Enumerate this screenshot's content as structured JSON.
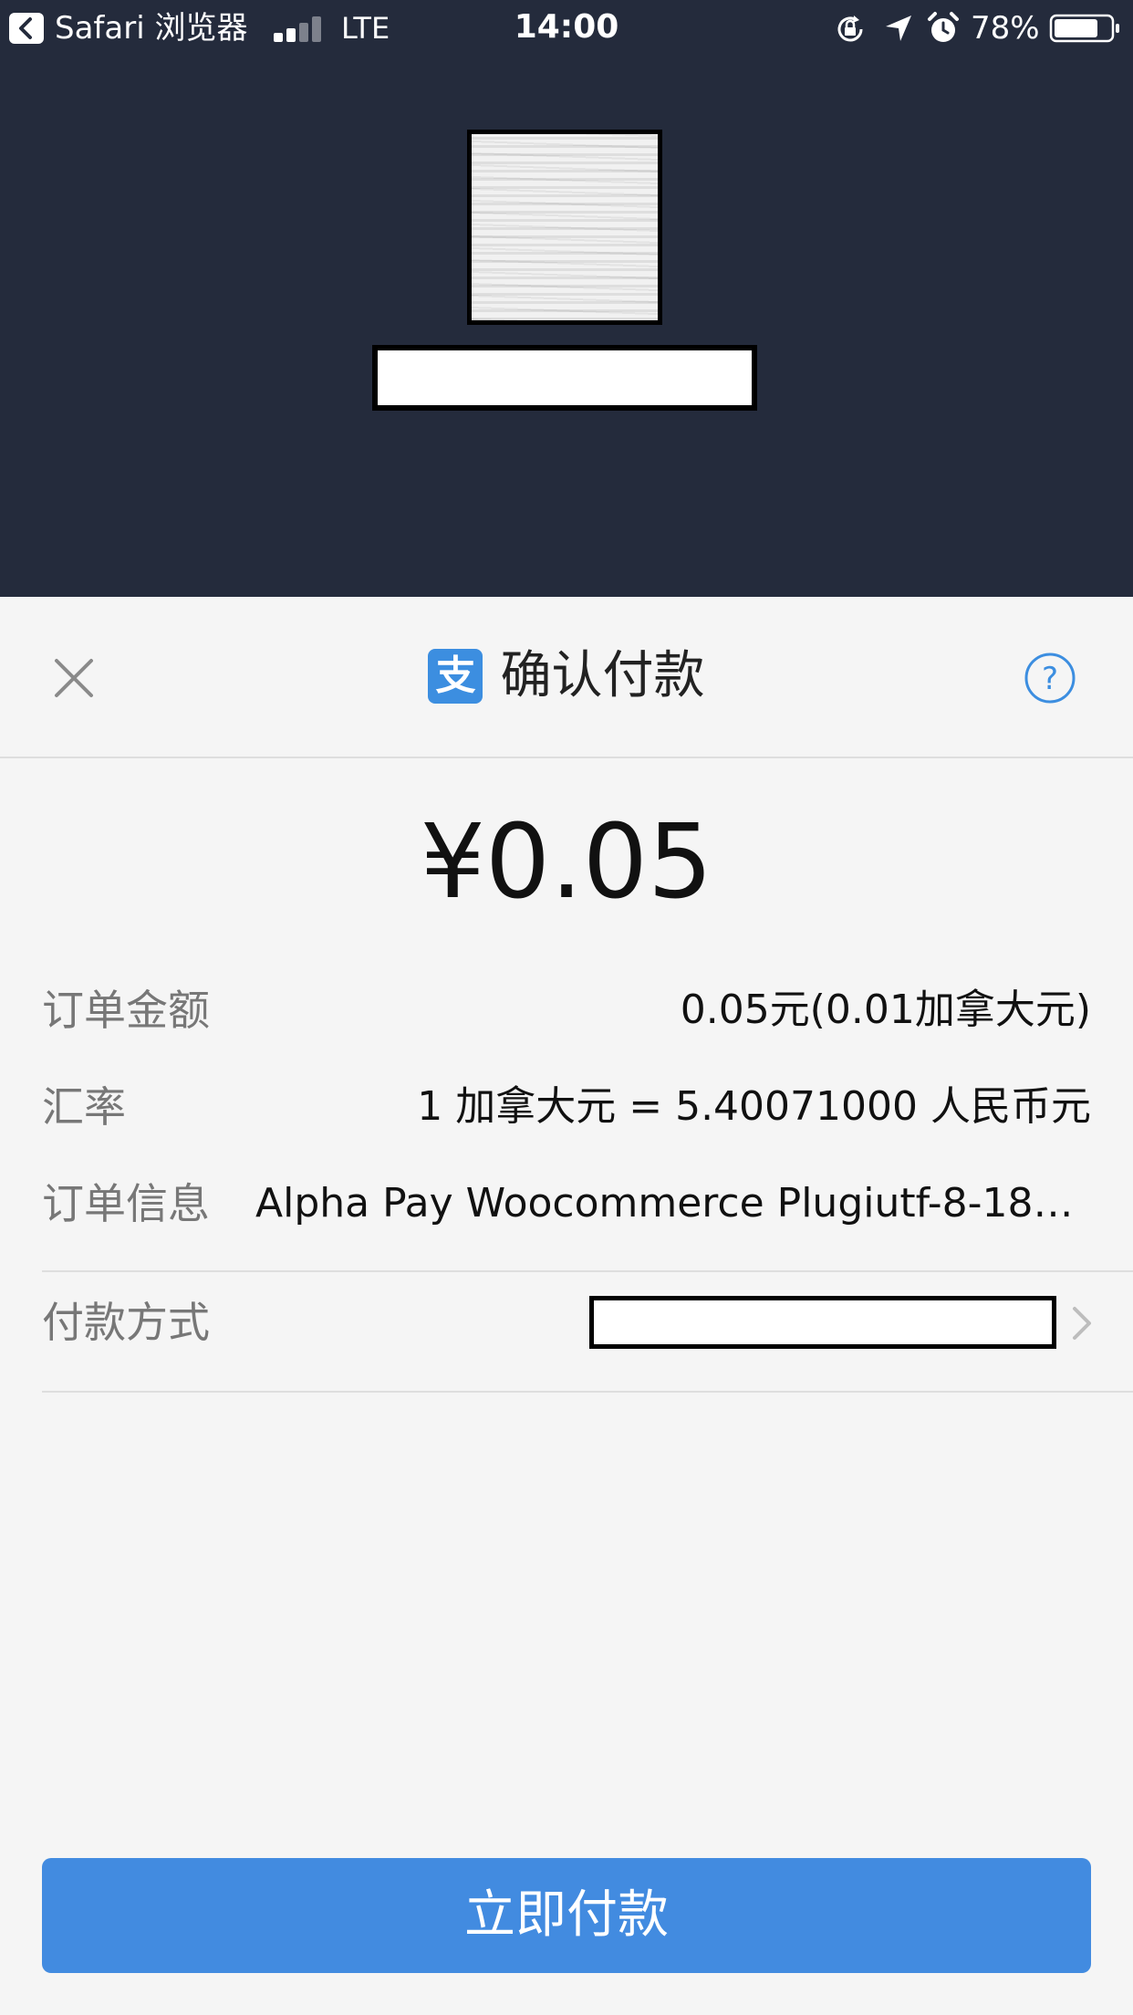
{
  "status_bar": {
    "back_app": "Safari 浏览器",
    "network": "LTE",
    "time": "14:00",
    "battery_percent": "78%",
    "battery_level": 0.78
  },
  "sheet": {
    "title": "确认付款",
    "amount": "¥0.05",
    "rows": [
      {
        "label": "订单金额",
        "value": "0.05元(0.01加拿大元)"
      },
      {
        "label": "汇率",
        "value": "1 加拿大元 = 5.40071000 人民币元"
      },
      {
        "label": "订单信息",
        "value": "Alpha Pay Woocommerce Plugiutf-8-181..."
      }
    ],
    "payment_method_label": "付款方式",
    "pay_button": "立即付款"
  },
  "colors": {
    "top_background": "#242b3c",
    "accent_blue": "#428be0",
    "sheet_background": "#f5f5f5"
  },
  "icons": [
    "back-arrow-icon",
    "signal-icon",
    "lock-rotation-icon",
    "location-icon",
    "alarm-icon",
    "battery-icon",
    "close-icon",
    "alipay-icon",
    "help-icon",
    "chevron-right-icon"
  ]
}
